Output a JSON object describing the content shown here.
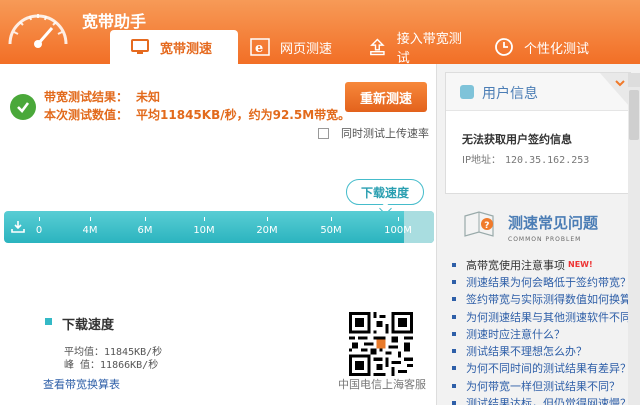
{
  "app": {
    "title": "宽带助手"
  },
  "tabs": [
    {
      "label": "宽带测速",
      "icon": "monitor-icon",
      "active": true
    },
    {
      "label": "网页测速",
      "icon": "ie-browser-icon",
      "active": false
    },
    {
      "label": "接入带宽测试",
      "icon": "upload-person-icon",
      "active": false
    },
    {
      "label": "个性化测试",
      "icon": "clock-icon",
      "active": false
    }
  ],
  "result": {
    "status_label": "带宽测试结果：",
    "status_value": "未知",
    "speed_label": "本次测试数值：",
    "speed_value": "平均11845KB/秒，约为92.5M带宽。",
    "retest_button": "重新测速",
    "upload_option": "同时测试上传速率",
    "upload_checked": false
  },
  "meter": {
    "speed_tag": "下载速度",
    "ticks": [
      "0",
      "4M",
      "6M",
      "10M",
      "20M",
      "50M",
      "100M"
    ],
    "fill_fraction": 0.93
  },
  "stats": {
    "title": "下载速度",
    "avg_label": "平均值：",
    "avg_value": "11845KB/秒",
    "peak_label": "峰  值：",
    "peak_value": "11866KB/秒",
    "conversion_link": "查看带宽换算表",
    "qr_caption": "中国电信上海客服"
  },
  "user": {
    "title": "用户信息",
    "message": "无法获取用户签约信息",
    "ip_label": "IP地址：",
    "ip_value": "120.35.162.253"
  },
  "faq": {
    "title": "测速常见问题",
    "subtitle": "COMMON PROBLEM",
    "items": [
      "高带宽使用注意事项",
      "测速结果为何会略低于签约带宽？",
      "签约带宽与实际测得数值如何换算？",
      "为何测速结果与其他测速软件不同？",
      "测速时应注意什么？",
      "测试结果不理想怎么办？",
      "为何不同时间的测试结果有差异？",
      "为何带宽一样但测试结果不同？",
      "测试结果达标，但仍觉得网速慢？"
    ],
    "new_badge": "NEW!"
  },
  "colors": {
    "brand": "#f26f26",
    "meter": "#2bb4bf",
    "link": "#2e5fa8"
  }
}
